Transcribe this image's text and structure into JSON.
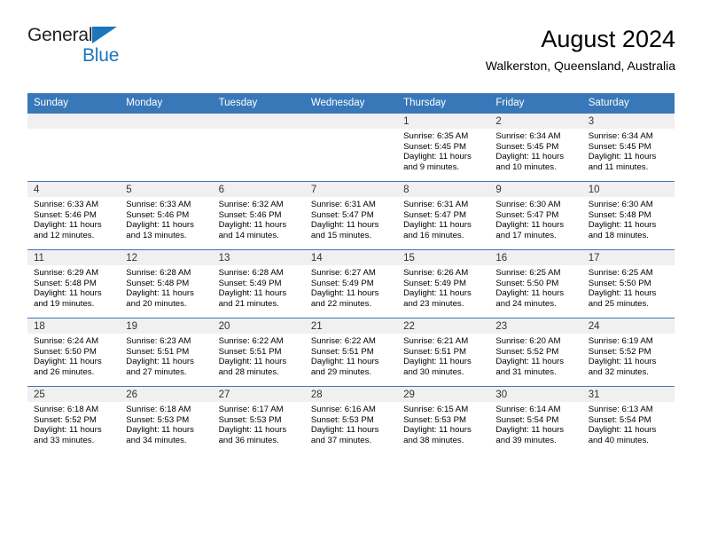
{
  "brand": {
    "name_top": "General",
    "name_bottom": "Blue",
    "triangle_color": "#1c76bc"
  },
  "header": {
    "title": "August 2024",
    "subtitle": "Walkerston, Queensland, Australia"
  },
  "theme": {
    "header_blue": "#3878b8",
    "daynum_band": "#f0f0f0",
    "brand_blue": "#1c76bc"
  },
  "weekday_headers": [
    "Sunday",
    "Monday",
    "Tuesday",
    "Wednesday",
    "Thursday",
    "Friday",
    "Saturday"
  ],
  "weeks": [
    [
      {
        "day": "",
        "sunrise": "",
        "sunset": "",
        "daylight_line1": "",
        "daylight_line2": ""
      },
      {
        "day": "",
        "sunrise": "",
        "sunset": "",
        "daylight_line1": "",
        "daylight_line2": ""
      },
      {
        "day": "",
        "sunrise": "",
        "sunset": "",
        "daylight_line1": "",
        "daylight_line2": ""
      },
      {
        "day": "",
        "sunrise": "",
        "sunset": "",
        "daylight_line1": "",
        "daylight_line2": ""
      },
      {
        "day": "1",
        "sunrise": "Sunrise: 6:35 AM",
        "sunset": "Sunset: 5:45 PM",
        "daylight_line1": "Daylight: 11 hours",
        "daylight_line2": "and 9 minutes."
      },
      {
        "day": "2",
        "sunrise": "Sunrise: 6:34 AM",
        "sunset": "Sunset: 5:45 PM",
        "daylight_line1": "Daylight: 11 hours",
        "daylight_line2": "and 10 minutes."
      },
      {
        "day": "3",
        "sunrise": "Sunrise: 6:34 AM",
        "sunset": "Sunset: 5:45 PM",
        "daylight_line1": "Daylight: 11 hours",
        "daylight_line2": "and 11 minutes."
      }
    ],
    [
      {
        "day": "4",
        "sunrise": "Sunrise: 6:33 AM",
        "sunset": "Sunset: 5:46 PM",
        "daylight_line1": "Daylight: 11 hours",
        "daylight_line2": "and 12 minutes."
      },
      {
        "day": "5",
        "sunrise": "Sunrise: 6:33 AM",
        "sunset": "Sunset: 5:46 PM",
        "daylight_line1": "Daylight: 11 hours",
        "daylight_line2": "and 13 minutes."
      },
      {
        "day": "6",
        "sunrise": "Sunrise: 6:32 AM",
        "sunset": "Sunset: 5:46 PM",
        "daylight_line1": "Daylight: 11 hours",
        "daylight_line2": "and 14 minutes."
      },
      {
        "day": "7",
        "sunrise": "Sunrise: 6:31 AM",
        "sunset": "Sunset: 5:47 PM",
        "daylight_line1": "Daylight: 11 hours",
        "daylight_line2": "and 15 minutes."
      },
      {
        "day": "8",
        "sunrise": "Sunrise: 6:31 AM",
        "sunset": "Sunset: 5:47 PM",
        "daylight_line1": "Daylight: 11 hours",
        "daylight_line2": "and 16 minutes."
      },
      {
        "day": "9",
        "sunrise": "Sunrise: 6:30 AM",
        "sunset": "Sunset: 5:47 PM",
        "daylight_line1": "Daylight: 11 hours",
        "daylight_line2": "and 17 minutes."
      },
      {
        "day": "10",
        "sunrise": "Sunrise: 6:30 AM",
        "sunset": "Sunset: 5:48 PM",
        "daylight_line1": "Daylight: 11 hours",
        "daylight_line2": "and 18 minutes."
      }
    ],
    [
      {
        "day": "11",
        "sunrise": "Sunrise: 6:29 AM",
        "sunset": "Sunset: 5:48 PM",
        "daylight_line1": "Daylight: 11 hours",
        "daylight_line2": "and 19 minutes."
      },
      {
        "day": "12",
        "sunrise": "Sunrise: 6:28 AM",
        "sunset": "Sunset: 5:48 PM",
        "daylight_line1": "Daylight: 11 hours",
        "daylight_line2": "and 20 minutes."
      },
      {
        "day": "13",
        "sunrise": "Sunrise: 6:28 AM",
        "sunset": "Sunset: 5:49 PM",
        "daylight_line1": "Daylight: 11 hours",
        "daylight_line2": "and 21 minutes."
      },
      {
        "day": "14",
        "sunrise": "Sunrise: 6:27 AM",
        "sunset": "Sunset: 5:49 PM",
        "daylight_line1": "Daylight: 11 hours",
        "daylight_line2": "and 22 minutes."
      },
      {
        "day": "15",
        "sunrise": "Sunrise: 6:26 AM",
        "sunset": "Sunset: 5:49 PM",
        "daylight_line1": "Daylight: 11 hours",
        "daylight_line2": "and 23 minutes."
      },
      {
        "day": "16",
        "sunrise": "Sunrise: 6:25 AM",
        "sunset": "Sunset: 5:50 PM",
        "daylight_line1": "Daylight: 11 hours",
        "daylight_line2": "and 24 minutes."
      },
      {
        "day": "17",
        "sunrise": "Sunrise: 6:25 AM",
        "sunset": "Sunset: 5:50 PM",
        "daylight_line1": "Daylight: 11 hours",
        "daylight_line2": "and 25 minutes."
      }
    ],
    [
      {
        "day": "18",
        "sunrise": "Sunrise: 6:24 AM",
        "sunset": "Sunset: 5:50 PM",
        "daylight_line1": "Daylight: 11 hours",
        "daylight_line2": "and 26 minutes."
      },
      {
        "day": "19",
        "sunrise": "Sunrise: 6:23 AM",
        "sunset": "Sunset: 5:51 PM",
        "daylight_line1": "Daylight: 11 hours",
        "daylight_line2": "and 27 minutes."
      },
      {
        "day": "20",
        "sunrise": "Sunrise: 6:22 AM",
        "sunset": "Sunset: 5:51 PM",
        "daylight_line1": "Daylight: 11 hours",
        "daylight_line2": "and 28 minutes."
      },
      {
        "day": "21",
        "sunrise": "Sunrise: 6:22 AM",
        "sunset": "Sunset: 5:51 PM",
        "daylight_line1": "Daylight: 11 hours",
        "daylight_line2": "and 29 minutes."
      },
      {
        "day": "22",
        "sunrise": "Sunrise: 6:21 AM",
        "sunset": "Sunset: 5:51 PM",
        "daylight_line1": "Daylight: 11 hours",
        "daylight_line2": "and 30 minutes."
      },
      {
        "day": "23",
        "sunrise": "Sunrise: 6:20 AM",
        "sunset": "Sunset: 5:52 PM",
        "daylight_line1": "Daylight: 11 hours",
        "daylight_line2": "and 31 minutes."
      },
      {
        "day": "24",
        "sunrise": "Sunrise: 6:19 AM",
        "sunset": "Sunset: 5:52 PM",
        "daylight_line1": "Daylight: 11 hours",
        "daylight_line2": "and 32 minutes."
      }
    ],
    [
      {
        "day": "25",
        "sunrise": "Sunrise: 6:18 AM",
        "sunset": "Sunset: 5:52 PM",
        "daylight_line1": "Daylight: 11 hours",
        "daylight_line2": "and 33 minutes."
      },
      {
        "day": "26",
        "sunrise": "Sunrise: 6:18 AM",
        "sunset": "Sunset: 5:53 PM",
        "daylight_line1": "Daylight: 11 hours",
        "daylight_line2": "and 34 minutes."
      },
      {
        "day": "27",
        "sunrise": "Sunrise: 6:17 AM",
        "sunset": "Sunset: 5:53 PM",
        "daylight_line1": "Daylight: 11 hours",
        "daylight_line2": "and 36 minutes."
      },
      {
        "day": "28",
        "sunrise": "Sunrise: 6:16 AM",
        "sunset": "Sunset: 5:53 PM",
        "daylight_line1": "Daylight: 11 hours",
        "daylight_line2": "and 37 minutes."
      },
      {
        "day": "29",
        "sunrise": "Sunrise: 6:15 AM",
        "sunset": "Sunset: 5:53 PM",
        "daylight_line1": "Daylight: 11 hours",
        "daylight_line2": "and 38 minutes."
      },
      {
        "day": "30",
        "sunrise": "Sunrise: 6:14 AM",
        "sunset": "Sunset: 5:54 PM",
        "daylight_line1": "Daylight: 11 hours",
        "daylight_line2": "and 39 minutes."
      },
      {
        "day": "31",
        "sunrise": "Sunrise: 6:13 AM",
        "sunset": "Sunset: 5:54 PM",
        "daylight_line1": "Daylight: 11 hours",
        "daylight_line2": "and 40 minutes."
      }
    ]
  ]
}
